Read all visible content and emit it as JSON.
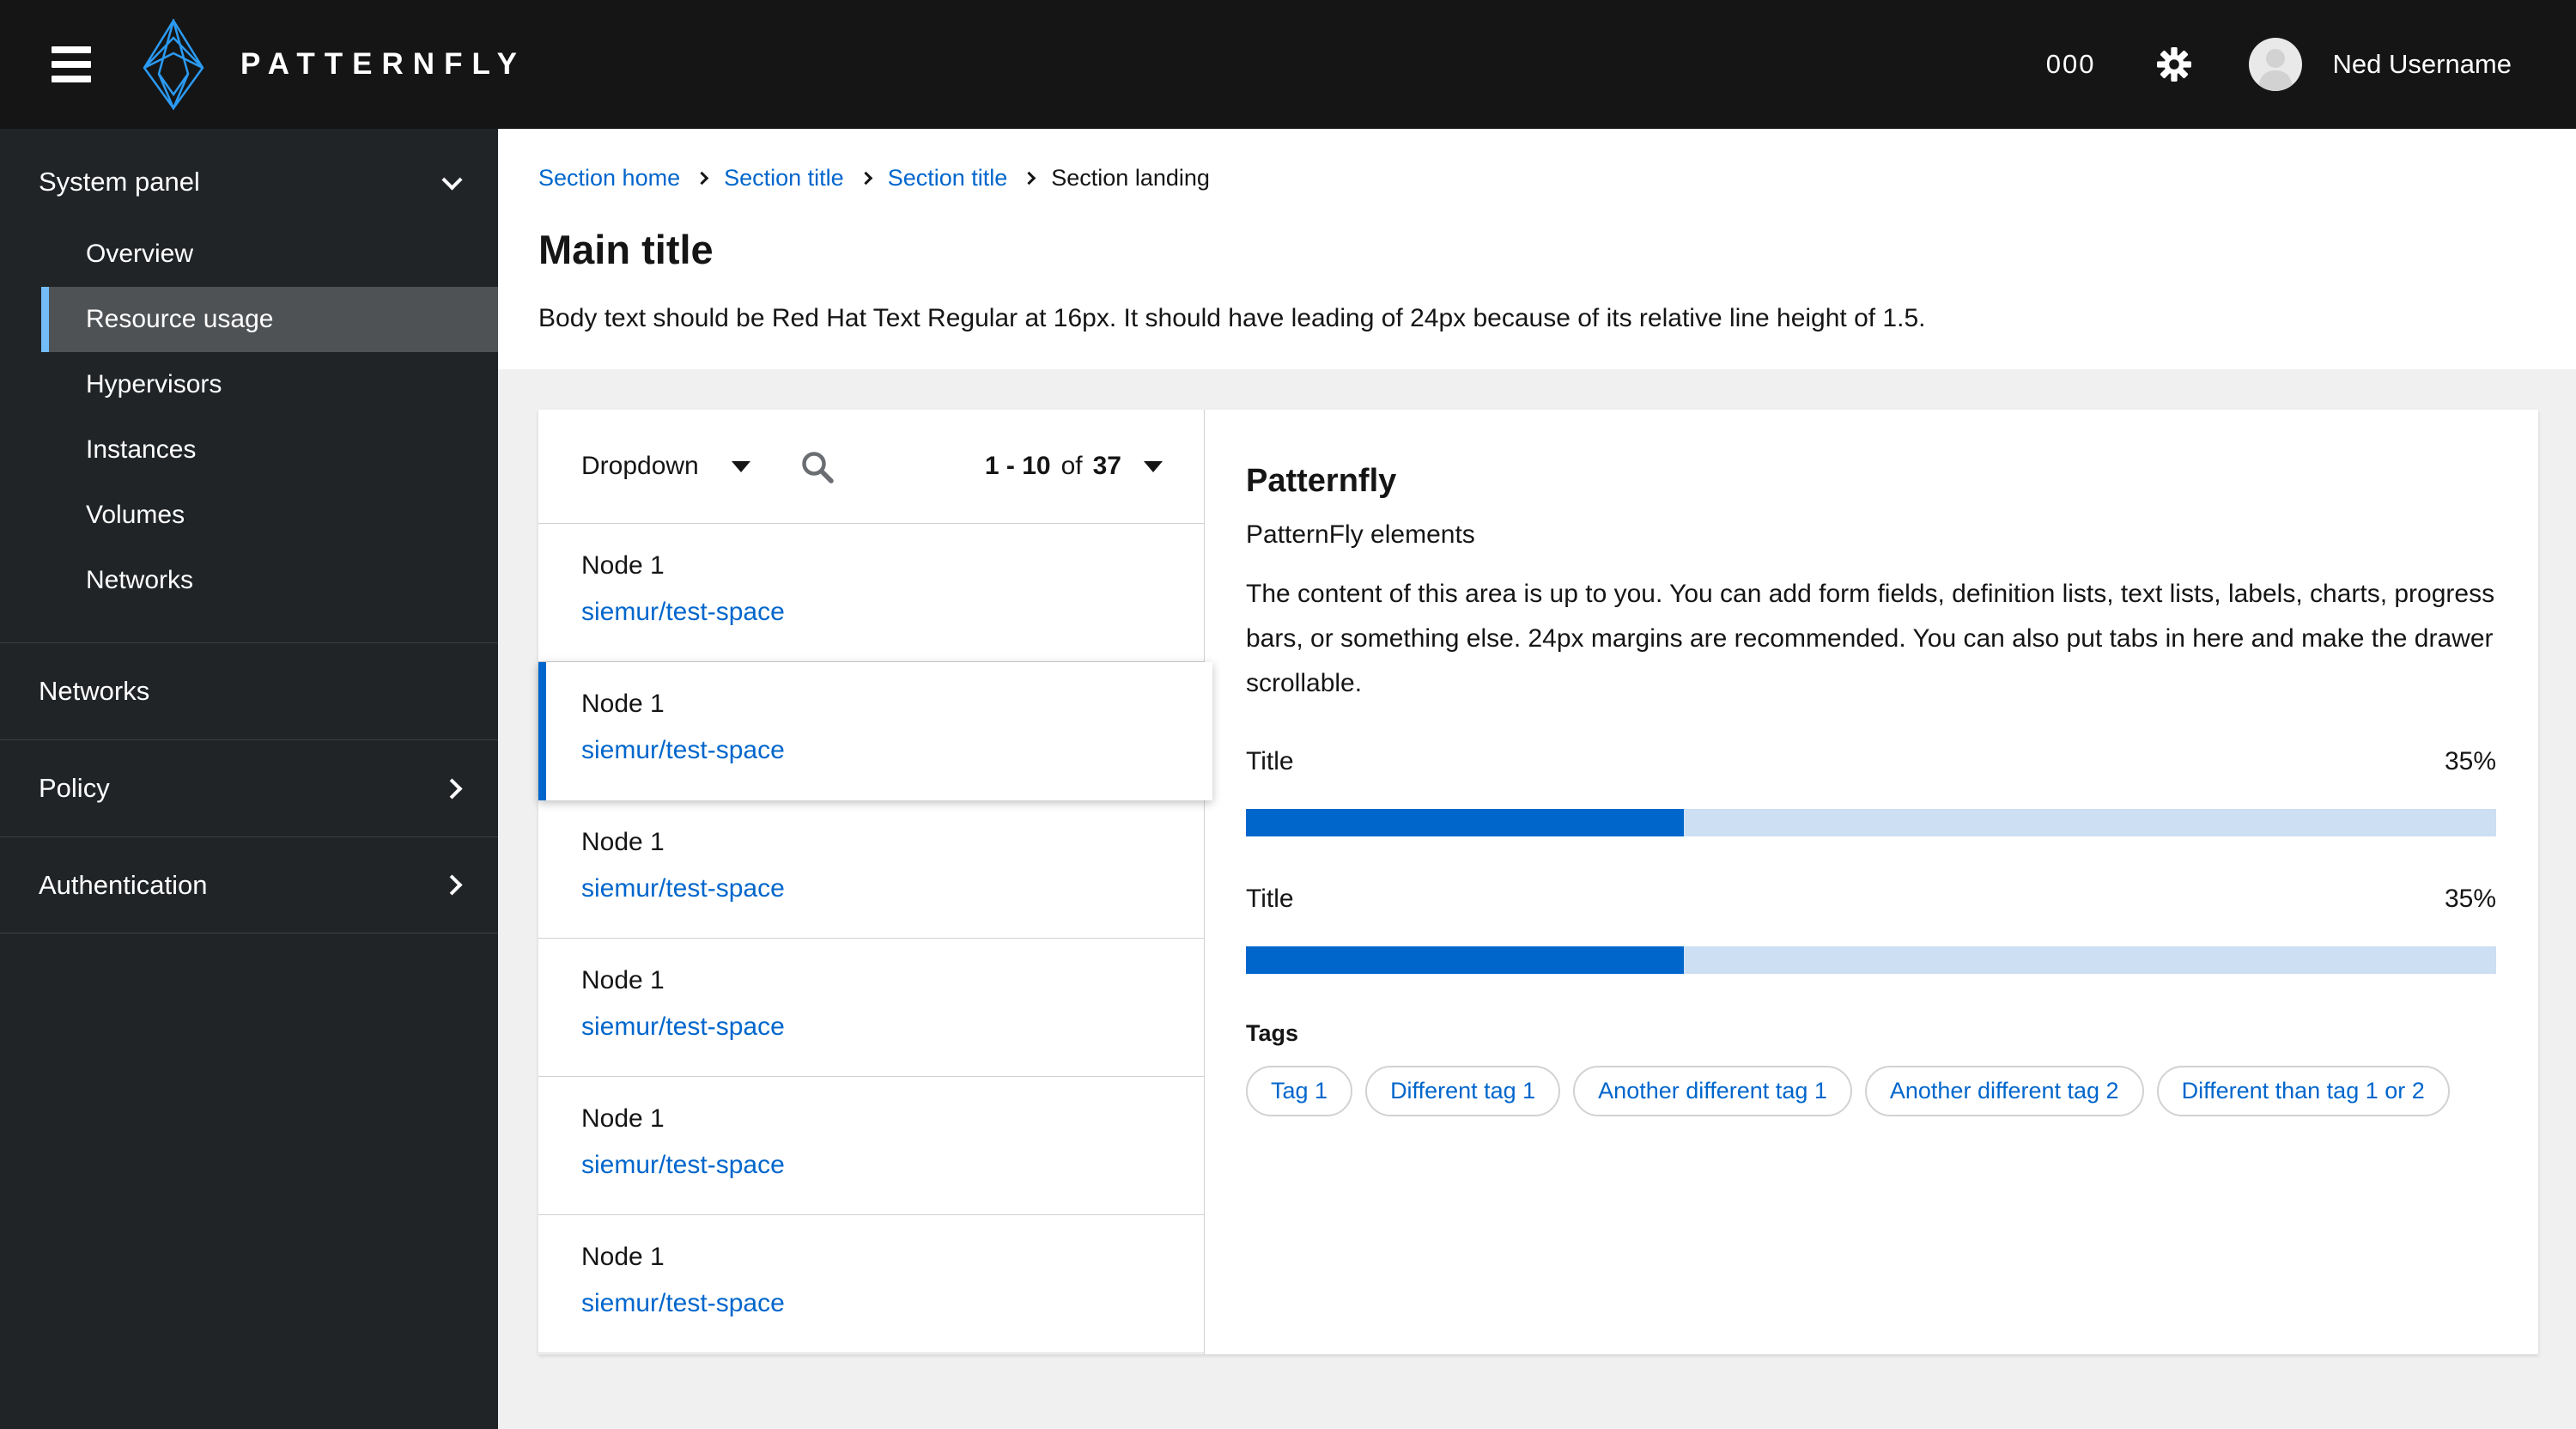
{
  "masthead": {
    "brand": "PATTERNFLY",
    "counter": "000",
    "username": "Ned Username"
  },
  "sidebar": {
    "sections": [
      {
        "label": "System panel",
        "chevron": "down",
        "items": [
          {
            "label": "Overview"
          },
          {
            "label": "Resource usage",
            "selected": true
          },
          {
            "label": "Hypervisors"
          },
          {
            "label": "Instances"
          },
          {
            "label": "Volumes"
          },
          {
            "label": "Networks"
          }
        ]
      },
      {
        "label": "Networks"
      },
      {
        "label": "Policy",
        "chevron": "right"
      },
      {
        "label": "Authentication",
        "chevron": "right"
      }
    ]
  },
  "breadcrumb": {
    "items": [
      {
        "label": "Section home"
      },
      {
        "label": "Section title"
      },
      {
        "label": "Section title"
      },
      {
        "label": "Section landing",
        "current": true
      }
    ]
  },
  "page": {
    "title": "Main title",
    "body": "Body text should be Red Hat Text Regular at 16px. It should have leading of 24px because of its relative line height of 1.5."
  },
  "toolbar": {
    "dropdown_label": "Dropdown",
    "pagination": {
      "range": "1 - 10",
      "of": "of",
      "total": "37"
    }
  },
  "list": {
    "selected_index": 1,
    "rows": [
      {
        "title": "Node 1",
        "link": "siemur/test-space"
      },
      {
        "title": "Node 1",
        "link": "siemur/test-space"
      },
      {
        "title": "Node 1",
        "link": "siemur/test-space"
      },
      {
        "title": "Node 1",
        "link": "siemur/test-space"
      },
      {
        "title": "Node 1",
        "link": "siemur/test-space"
      },
      {
        "title": "Node 1",
        "link": "siemur/test-space"
      }
    ]
  },
  "drawer": {
    "title": "Patternfly",
    "subtitle": "PatternFly elements",
    "body": "The content of this area is up to you. You can add form fields, definition lists, text lists, labels, charts, progress bars, or something else. 24px margins are recommended. You can also put tabs in here and make the drawer scrollable.",
    "progress": [
      {
        "label": "Title",
        "value": "35%",
        "percent": 35
      },
      {
        "label": "Title",
        "value": "35%",
        "percent": 35
      }
    ],
    "tags_label": "Tags",
    "tags": [
      "Tag 1",
      "Different tag 1",
      "Another different tag 1",
      "Another different tag 2",
      "Different than tag 1 or 2"
    ]
  },
  "icons": {
    "menu": "hamburger-icon",
    "brand": "patternfly-logo-icon",
    "settings": "gear-icon",
    "user": "avatar-icon",
    "search": "search-icon",
    "expand": "chevron-down-icon",
    "collapse": "chevron-right-icon"
  },
  "colors": {
    "accent": "#0066cc",
    "masthead_bg": "#151515",
    "sidebar_bg": "#212427",
    "nav_selected_bg": "#4f5255",
    "nav_selected_border": "#73bcf7",
    "content_bg": "#f0f0f0",
    "border": "#d2d2d2",
    "progress_track": "#cddff2",
    "logo_blue": "#2b9af3"
  }
}
